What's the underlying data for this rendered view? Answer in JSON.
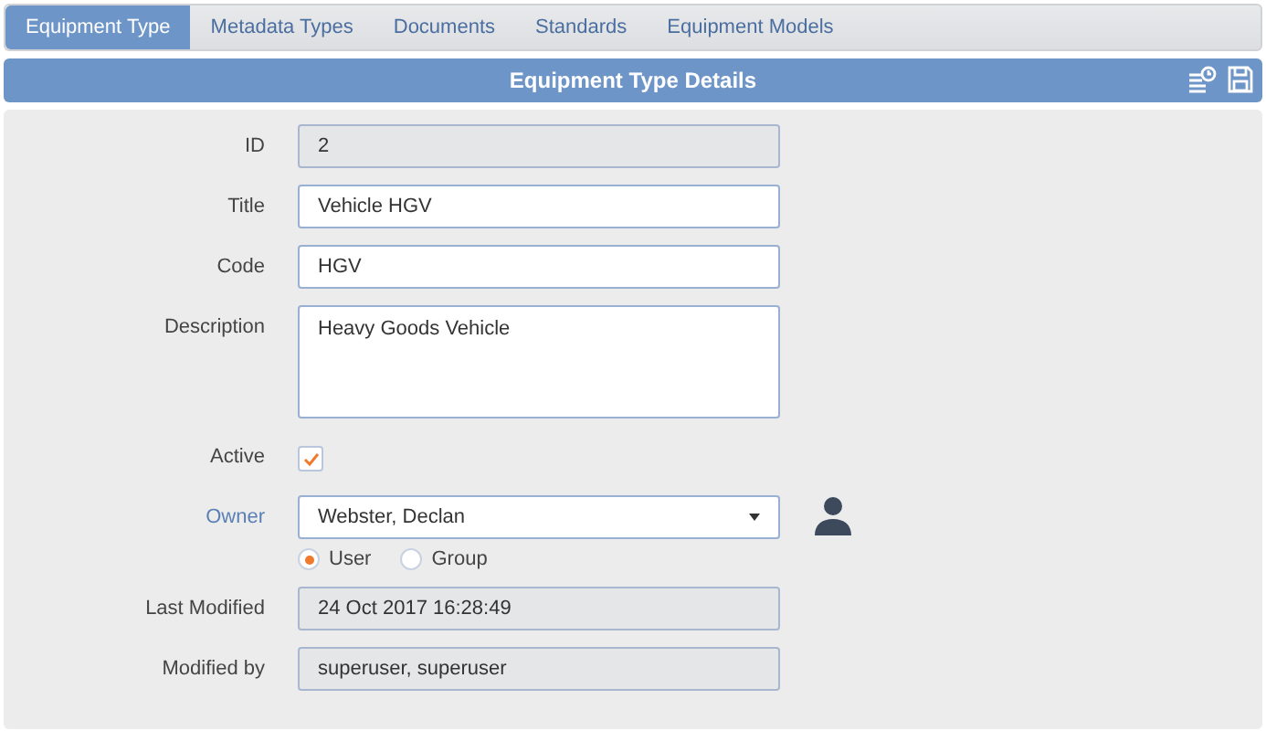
{
  "tabs": [
    {
      "label": "Equipment Type",
      "selected": true
    },
    {
      "label": "Metadata Types",
      "selected": false
    },
    {
      "label": "Documents",
      "selected": false
    },
    {
      "label": "Standards",
      "selected": false
    },
    {
      "label": "Equipment Models",
      "selected": false
    }
  ],
  "header": {
    "title": "Equipment Type Details"
  },
  "fields": [
    {
      "kind": "readonly",
      "label": "ID",
      "value": "2"
    },
    {
      "kind": "text",
      "label": "Title",
      "value": "Vehicle HGV"
    },
    {
      "kind": "text",
      "label": "Code",
      "value": "HGV"
    },
    {
      "kind": "textarea",
      "label": "Description",
      "value": "Heavy Goods Vehicle"
    },
    {
      "kind": "checkbox",
      "label": "Active",
      "checked": true
    },
    {
      "kind": "owner",
      "label": "Owner",
      "value": "Webster, Declan",
      "options": [
        {
          "label": "User",
          "selected": true
        },
        {
          "label": "Group",
          "selected": false
        }
      ]
    },
    {
      "kind": "readonly",
      "label": "Last Modified",
      "value": "24 Oct 2017 16:28:49"
    },
    {
      "kind": "readonly",
      "label": "Modified by",
      "value": "superuser, superuser"
    }
  ]
}
